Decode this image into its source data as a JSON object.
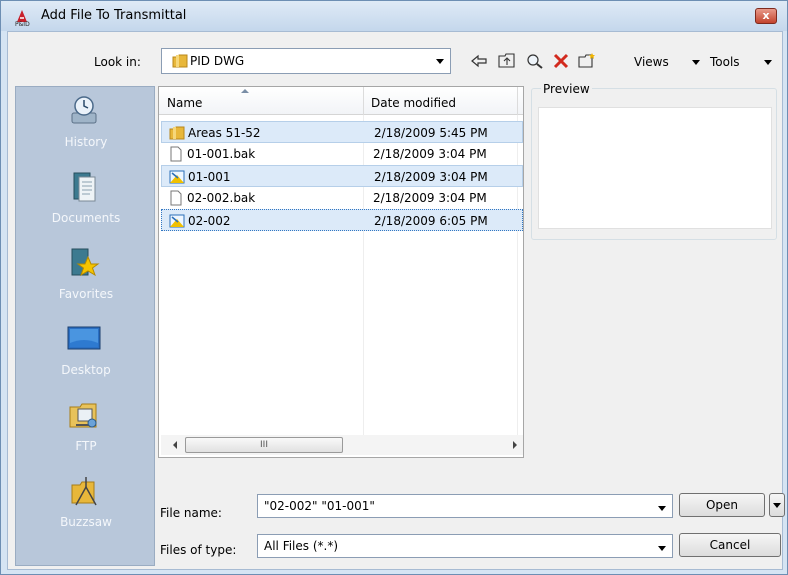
{
  "window": {
    "title": "Add File To Transmittal",
    "close_label": "x"
  },
  "lookin": {
    "label": "Look in:",
    "value": "PID DWG"
  },
  "toolbar": {
    "views_label": "Views",
    "tools_label": "Tools"
  },
  "places": [
    {
      "label": "History",
      "icon": "history-icon"
    },
    {
      "label": "Documents",
      "icon": "documents-icon"
    },
    {
      "label": "Favorites",
      "icon": "favorites-icon"
    },
    {
      "label": "Desktop",
      "icon": "desktop-icon"
    },
    {
      "label": "FTP",
      "icon": "ftp-icon"
    },
    {
      "label": "Buzzsaw",
      "icon": "buzzsaw-icon"
    }
  ],
  "file_list": {
    "columns": {
      "name": "Name",
      "date": "Date modified"
    },
    "rows": [
      {
        "name": "Areas 51-52",
        "date": "2/18/2009 5:45 PM",
        "type": "folder",
        "selected": true
      },
      {
        "name": "01-001.bak",
        "date": "2/18/2009 3:04 PM",
        "type": "file",
        "selected": false
      },
      {
        "name": "01-001",
        "date": "2/18/2009 3:04 PM",
        "type": "dwg",
        "selected": true
      },
      {
        "name": "02-002.bak",
        "date": "2/18/2009 3:04 PM",
        "type": "file",
        "selected": false
      },
      {
        "name": "02-002",
        "date": "2/18/2009 6:05 PM",
        "type": "dwg",
        "selected": true
      }
    ],
    "scroll_thumb_glyph": "III"
  },
  "preview": {
    "label": "Preview"
  },
  "file_name": {
    "label": "File name:",
    "value": "\"02-002\" \"01-001\""
  },
  "file_type": {
    "label": "Files of type:",
    "value": "All Files (*.*)"
  },
  "buttons": {
    "open": "Open",
    "cancel": "Cancel"
  },
  "colors": {
    "selection": "#dceaf9",
    "places_bg": "#b8c7da",
    "accent": "#3377c2"
  }
}
